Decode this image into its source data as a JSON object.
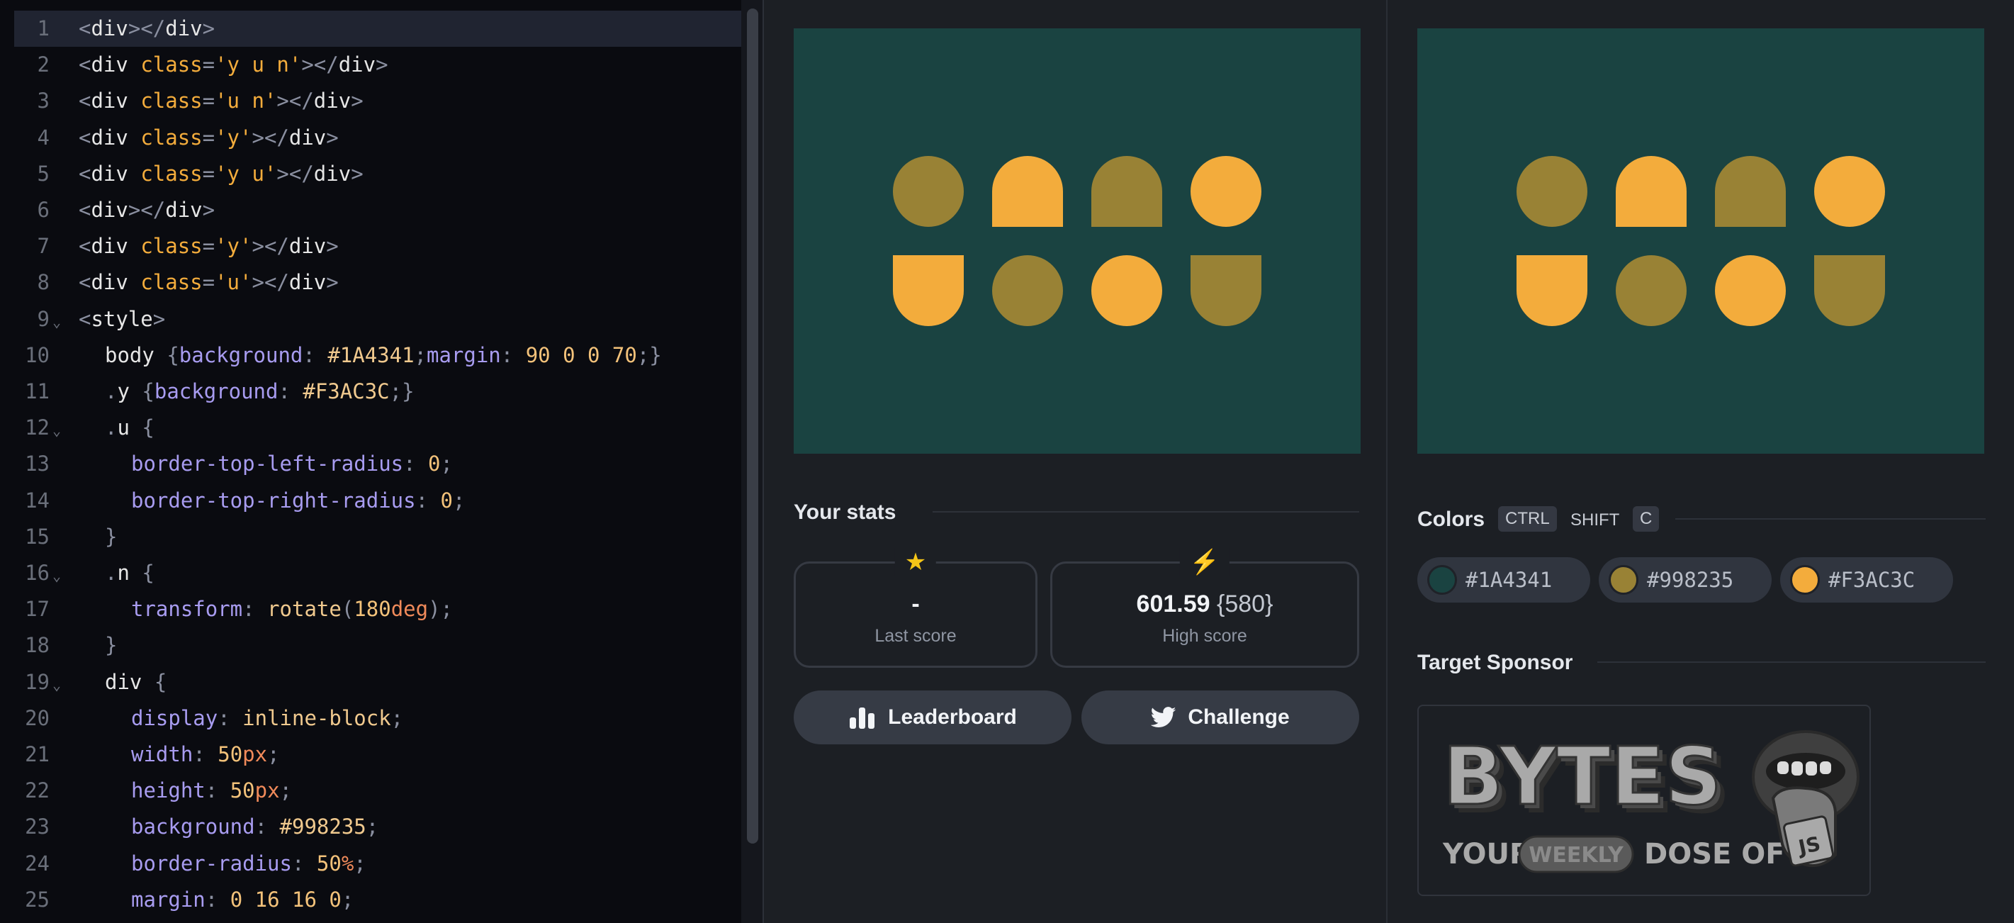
{
  "editor": {
    "lines": [
      {
        "n": "1",
        "fold": false,
        "active": true,
        "indent": 0,
        "tokens": [
          [
            "t-punc",
            "<"
          ],
          [
            "t-tag",
            "div"
          ],
          [
            "t-punc",
            "></"
          ],
          [
            "t-tag",
            "div"
          ],
          [
            "t-punc",
            ">"
          ]
        ]
      },
      {
        "n": "2",
        "fold": false,
        "indent": 0,
        "tokens": [
          [
            "t-punc",
            "<"
          ],
          [
            "t-tag",
            "div "
          ],
          [
            "t-attr",
            "class"
          ],
          [
            "t-punc",
            "="
          ],
          [
            "t-str",
            "'y u n'"
          ],
          [
            "t-punc",
            "></"
          ],
          [
            "t-tag",
            "div"
          ],
          [
            "t-punc",
            ">"
          ]
        ]
      },
      {
        "n": "3",
        "fold": false,
        "indent": 0,
        "tokens": [
          [
            "t-punc",
            "<"
          ],
          [
            "t-tag",
            "div "
          ],
          [
            "t-attr",
            "class"
          ],
          [
            "t-punc",
            "="
          ],
          [
            "t-str",
            "'u n'"
          ],
          [
            "t-punc",
            "></"
          ],
          [
            "t-tag",
            "div"
          ],
          [
            "t-punc",
            ">"
          ]
        ]
      },
      {
        "n": "4",
        "fold": false,
        "indent": 0,
        "tokens": [
          [
            "t-punc",
            "<"
          ],
          [
            "t-tag",
            "div "
          ],
          [
            "t-attr",
            "class"
          ],
          [
            "t-punc",
            "="
          ],
          [
            "t-str",
            "'y'"
          ],
          [
            "t-punc",
            "></"
          ],
          [
            "t-tag",
            "div"
          ],
          [
            "t-punc",
            ">"
          ]
        ]
      },
      {
        "n": "5",
        "fold": false,
        "indent": 0,
        "tokens": [
          [
            "t-punc",
            "<"
          ],
          [
            "t-tag",
            "div "
          ],
          [
            "t-attr",
            "class"
          ],
          [
            "t-punc",
            "="
          ],
          [
            "t-str",
            "'y u'"
          ],
          [
            "t-punc",
            "></"
          ],
          [
            "t-tag",
            "div"
          ],
          [
            "t-punc",
            ">"
          ]
        ]
      },
      {
        "n": "6",
        "fold": false,
        "indent": 0,
        "tokens": [
          [
            "t-punc",
            "<"
          ],
          [
            "t-tag",
            "div"
          ],
          [
            "t-punc",
            "></"
          ],
          [
            "t-tag",
            "div"
          ],
          [
            "t-punc",
            ">"
          ]
        ]
      },
      {
        "n": "7",
        "fold": false,
        "indent": 0,
        "tokens": [
          [
            "t-punc",
            "<"
          ],
          [
            "t-tag",
            "div "
          ],
          [
            "t-attr",
            "class"
          ],
          [
            "t-punc",
            "="
          ],
          [
            "t-str",
            "'y'"
          ],
          [
            "t-punc",
            "></"
          ],
          [
            "t-tag",
            "div"
          ],
          [
            "t-punc",
            ">"
          ]
        ]
      },
      {
        "n": "8",
        "fold": false,
        "indent": 0,
        "tokens": [
          [
            "t-punc",
            "<"
          ],
          [
            "t-tag",
            "div "
          ],
          [
            "t-attr",
            "class"
          ],
          [
            "t-punc",
            "="
          ],
          [
            "t-str",
            "'u'"
          ],
          [
            "t-punc",
            "></"
          ],
          [
            "t-tag",
            "div"
          ],
          [
            "t-punc",
            ">"
          ]
        ]
      },
      {
        "n": "9",
        "fold": true,
        "indent": 0,
        "tokens": [
          [
            "t-punc",
            "<"
          ],
          [
            "t-tag",
            "style"
          ],
          [
            "t-punc",
            ">"
          ]
        ]
      },
      {
        "n": "10",
        "fold": false,
        "indent": 1,
        "tokens": [
          [
            "t-sel",
            "body "
          ],
          [
            "t-punc",
            "{"
          ],
          [
            "t-prop",
            "background"
          ],
          [
            "t-punc",
            ": "
          ],
          [
            "t-val",
            "#1A4341"
          ],
          [
            "t-punc",
            ";"
          ],
          [
            "t-prop",
            "margin"
          ],
          [
            "t-punc",
            ": "
          ],
          [
            "t-num",
            "90 0 0 70"
          ],
          [
            "t-punc",
            ";}"
          ]
        ]
      },
      {
        "n": "11",
        "fold": false,
        "indent": 1,
        "tokens": [
          [
            "t-punc",
            "."
          ],
          [
            "t-sel",
            "y "
          ],
          [
            "t-punc",
            "{"
          ],
          [
            "t-prop",
            "background"
          ],
          [
            "t-punc",
            ": "
          ],
          [
            "t-val",
            "#F3AC3C"
          ],
          [
            "t-punc",
            ";}"
          ]
        ]
      },
      {
        "n": "12",
        "fold": true,
        "indent": 1,
        "tokens": [
          [
            "t-punc",
            "."
          ],
          [
            "t-sel",
            "u "
          ],
          [
            "t-punc",
            "{"
          ]
        ]
      },
      {
        "n": "13",
        "fold": false,
        "indent": 2,
        "tokens": [
          [
            "t-prop",
            "border-top-left-radius"
          ],
          [
            "t-punc",
            ": "
          ],
          [
            "t-num",
            "0"
          ],
          [
            "t-punc",
            ";"
          ]
        ]
      },
      {
        "n": "14",
        "fold": false,
        "indent": 2,
        "tokens": [
          [
            "t-prop",
            "border-top-right-radius"
          ],
          [
            "t-punc",
            ": "
          ],
          [
            "t-num",
            "0"
          ],
          [
            "t-punc",
            ";"
          ]
        ]
      },
      {
        "n": "15",
        "fold": false,
        "indent": 1,
        "tokens": [
          [
            "t-punc",
            "}"
          ]
        ]
      },
      {
        "n": "16",
        "fold": true,
        "indent": 1,
        "tokens": [
          [
            "t-punc",
            "."
          ],
          [
            "t-sel",
            "n "
          ],
          [
            "t-punc",
            "{"
          ]
        ]
      },
      {
        "n": "17",
        "fold": false,
        "indent": 2,
        "tokens": [
          [
            "t-prop",
            "transform"
          ],
          [
            "t-punc",
            ": "
          ],
          [
            "t-val",
            "rotate"
          ],
          [
            "t-punc",
            "("
          ],
          [
            "t-num",
            "180"
          ],
          [
            "t-unit",
            "deg"
          ],
          [
            "t-punc",
            ");"
          ]
        ]
      },
      {
        "n": "18",
        "fold": false,
        "indent": 1,
        "tokens": [
          [
            "t-punc",
            "}"
          ]
        ]
      },
      {
        "n": "19",
        "fold": true,
        "indent": 1,
        "tokens": [
          [
            "t-sel",
            "div "
          ],
          [
            "t-punc",
            "{"
          ]
        ]
      },
      {
        "n": "20",
        "fold": false,
        "indent": 2,
        "tokens": [
          [
            "t-prop",
            "display"
          ],
          [
            "t-punc",
            ": "
          ],
          [
            "t-val",
            "inline-block"
          ],
          [
            "t-punc",
            ";"
          ]
        ]
      },
      {
        "n": "21",
        "fold": false,
        "indent": 2,
        "tokens": [
          [
            "t-prop",
            "width"
          ],
          [
            "t-punc",
            ": "
          ],
          [
            "t-num",
            "50"
          ],
          [
            "t-unit",
            "px"
          ],
          [
            "t-punc",
            ";"
          ]
        ]
      },
      {
        "n": "22",
        "fold": false,
        "indent": 2,
        "tokens": [
          [
            "t-prop",
            "height"
          ],
          [
            "t-punc",
            ": "
          ],
          [
            "t-num",
            "50"
          ],
          [
            "t-unit",
            "px"
          ],
          [
            "t-punc",
            ";"
          ]
        ]
      },
      {
        "n": "23",
        "fold": false,
        "indent": 2,
        "tokens": [
          [
            "t-prop",
            "background"
          ],
          [
            "t-punc",
            ": "
          ],
          [
            "t-val",
            "#998235"
          ],
          [
            "t-punc",
            ";"
          ]
        ]
      },
      {
        "n": "24",
        "fold": false,
        "indent": 2,
        "tokens": [
          [
            "t-prop",
            "border-radius"
          ],
          [
            "t-punc",
            ": "
          ],
          [
            "t-num",
            "50"
          ],
          [
            "t-unit",
            "%"
          ],
          [
            "t-punc",
            ";"
          ]
        ]
      },
      {
        "n": "25",
        "fold": false,
        "indent": 2,
        "tokens": [
          [
            "t-prop",
            "margin"
          ],
          [
            "t-punc",
            ": "
          ],
          [
            "t-num",
            "0 16 16 0"
          ],
          [
            "t-punc",
            ";"
          ]
        ]
      }
    ]
  },
  "colors": {
    "background": "#1A4341",
    "olive": "#998235",
    "yellow": "#F3AC3C"
  },
  "preview_shapes": [
    {
      "cls": ""
    },
    {
      "cls": "y u n"
    },
    {
      "cls": "u n"
    },
    {
      "cls": "y"
    },
    {
      "cls": "y u"
    },
    {
      "cls": ""
    },
    {
      "cls": "y"
    },
    {
      "cls": "u"
    }
  ],
  "stats": {
    "title": "Your stats",
    "last_score": {
      "icon": "★",
      "value": "-",
      "label": "Last score"
    },
    "high_score": {
      "icon": "⚡",
      "value": "601.59",
      "best": "{580}",
      "label": "High score"
    }
  },
  "buttons": {
    "leaderboard": "Leaderboard",
    "challenge": "Challenge"
  },
  "colors_section": {
    "title": "Colors",
    "shortcut": [
      "CTRL",
      "SHIFT",
      "C"
    ],
    "chips": [
      "#1A4341",
      "#998235",
      "#F3AC3C"
    ]
  },
  "sponsor": {
    "title": "Target Sponsor",
    "logo_text": [
      "BYTES",
      "YOUR",
      "WEEKLY",
      "DOSE OF",
      "JS"
    ]
  }
}
